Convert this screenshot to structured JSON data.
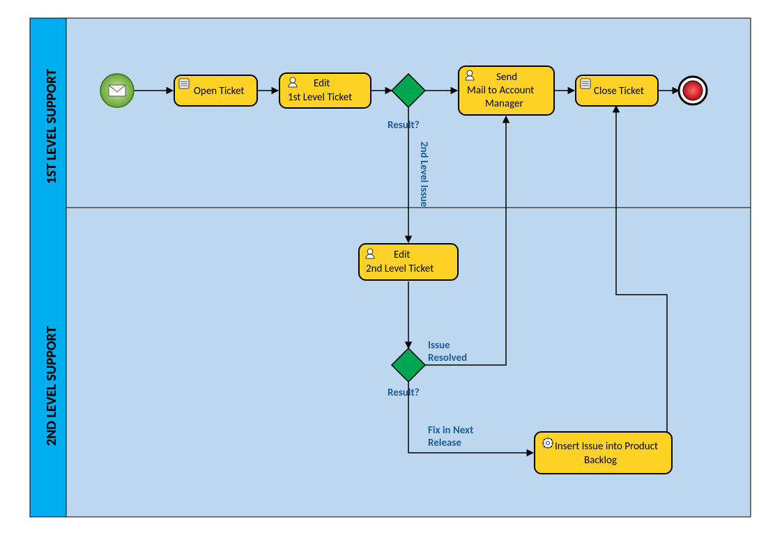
{
  "pool": {
    "lane1": {
      "title": "1ST LEVEL SUPPORT"
    },
    "lane2": {
      "title": "2ND LEVEL SUPPORT"
    }
  },
  "tasks": {
    "openTicket": "Open Ticket",
    "editL1a": "Edit",
    "editL1b": "1st Level Ticket",
    "sendMail1": "Send",
    "sendMail2": "Mail to Account",
    "sendMail3": "Manager",
    "closeTicket": "Close Ticket",
    "editL2a": "Edit",
    "editL2b": "2nd Level Ticket",
    "backlog1": "Insert Issue into Product",
    "backlog2": "Backlog"
  },
  "labels": {
    "result1": "Result?",
    "result2": "Result?",
    "l2issue": "2nd Level Issue",
    "resolved1": "Issue",
    "resolved2": "Resolved",
    "fix1": "Fix in Next",
    "fix2": "Release"
  },
  "colors": {
    "poolHeader": "#00aeef",
    "laneFill": "#bdd7ee",
    "taskFill": "#ffd228",
    "taskStroke": "#000000",
    "gatewayFill": "#00a651",
    "startFill": "#7ac142",
    "endFill": "#ed1c24",
    "label": "#1f5c9e"
  }
}
